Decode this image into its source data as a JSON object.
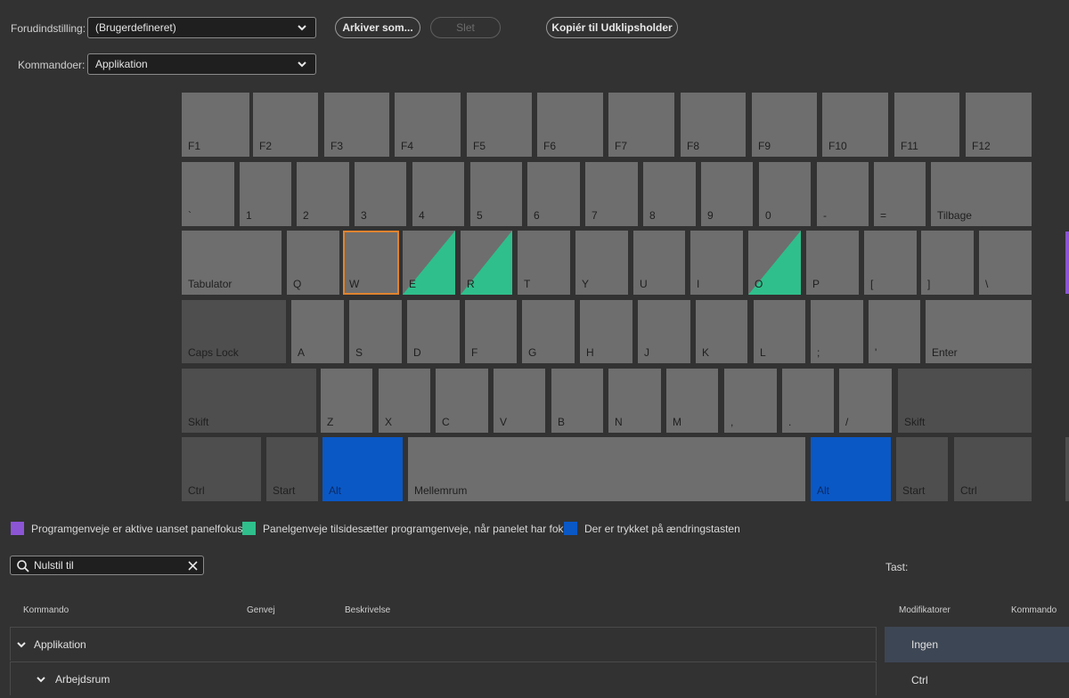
{
  "toolbar": {
    "preset_label": "Forudindstilling:",
    "preset_value": "(Brugerdefineret)",
    "save_as_label": "Arkiver som...",
    "delete_label": "Slet",
    "copy_label": "Kopiér til Udklipsholder",
    "commands_label": "Kommandoer:",
    "commands_value": "Applikation"
  },
  "keyboard": {
    "row1": [
      "F1",
      "F2",
      "F3",
      "F4",
      "F5",
      "F6",
      "F7",
      "F8",
      "F9",
      "F10",
      "F11",
      "F12"
    ],
    "row2": [
      "`",
      "1",
      "2",
      "3",
      "4",
      "5",
      "6",
      "7",
      "8",
      "9",
      "0",
      "-",
      "=",
      "Tilbage"
    ],
    "row3": [
      "Tabulator",
      "Q",
      "W",
      "E",
      "R",
      "T",
      "Y",
      "U",
      "I",
      "O",
      "P",
      "[",
      "]",
      "\\"
    ],
    "row4": [
      "Caps Lock",
      "A",
      "S",
      "D",
      "F",
      "G",
      "H",
      "J",
      "K",
      "L",
      ";",
      "'",
      "Enter"
    ],
    "row5": [
      "Skift",
      "Z",
      "X",
      "C",
      "V",
      "B",
      "N",
      "M",
      ",",
      ".",
      "/",
      "Skift"
    ],
    "row6": [
      "Ctrl",
      "Start",
      "Alt",
      "Mellemrum",
      "Alt",
      "Start",
      "Ctrl"
    ],
    "selected_key": "W",
    "panel_shortcut_keys": [
      "E",
      "R",
      "O"
    ],
    "pressed_modifier": "Alt"
  },
  "legend": {
    "app_shortcuts": "Programgenveje er aktive uanset panelfokus",
    "panel_shortcuts": "Panelgenveje tilsidesætter programgenveje, når panelet har fokus",
    "modifier_pressed": "Der er trykket på ændringstasten"
  },
  "colors": {
    "key": "#6e6e6e",
    "modifier_key": "#4e4e4e",
    "pressed": "#0a58c6",
    "panel": "#2fbf8c",
    "app": "#8c55d6",
    "selection": "#e0832f"
  },
  "search": {
    "value": "Nulstil til"
  },
  "table": {
    "headers": {
      "command": "Kommando",
      "shortcut": "Genvej",
      "description": "Beskrivelse"
    },
    "rows": [
      {
        "label": "Applikation"
      },
      {
        "label": "Arbejdsrum"
      }
    ]
  },
  "key_panel": {
    "key_label": "Tast:",
    "modifiers_header": "Modifikatorer",
    "command_header": "Kommando",
    "modifiers": [
      "Ingen",
      "Ctrl"
    ]
  }
}
